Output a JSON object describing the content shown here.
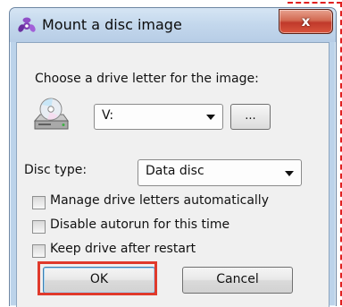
{
  "window": {
    "title": "Mount a disc image",
    "close_symbol": "x",
    "icon": "mount-app-icon"
  },
  "drive": {
    "label": "Choose a drive letter for the image:",
    "icon": "disc-drive-icon",
    "selected": "V:",
    "browse_label": "..."
  },
  "disc_type": {
    "label": "Disc type:",
    "selected": "Data disc"
  },
  "options": [
    {
      "label": "Manage drive letters automatically",
      "checked": false
    },
    {
      "label": "Disable autorun for this time",
      "checked": false
    },
    {
      "label": "Keep drive after restart",
      "checked": false
    }
  ],
  "buttons": {
    "ok": "OK",
    "cancel": "Cancel"
  },
  "colors": {
    "highlight": "#e03a2c",
    "close_button": "#c0392b"
  }
}
